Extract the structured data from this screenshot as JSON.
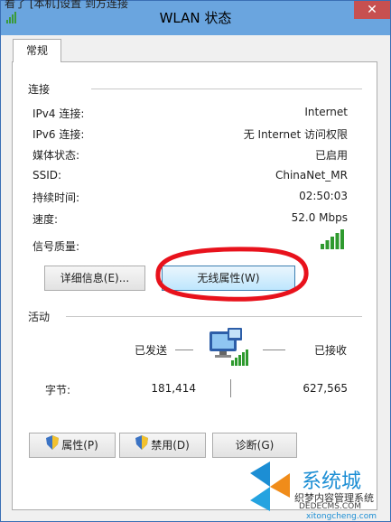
{
  "window": {
    "title": "WLAN 状态",
    "overlay_text": "看了 [本机]设置 到方连接",
    "close_label": "✕"
  },
  "tabs": [
    {
      "label": "常规"
    }
  ],
  "connection": {
    "section_title": "连接",
    "rows": [
      {
        "label": "IPv4 连接:",
        "value": "Internet"
      },
      {
        "label": "IPv6 连接:",
        "value": "无 Internet 访问权限"
      },
      {
        "label": "媒体状态:",
        "value": "已启用"
      },
      {
        "label": "SSID:",
        "value": "ChinaNet_MR"
      },
      {
        "label": "持续时间:",
        "value": "02:50:03"
      },
      {
        "label": "速度:",
        "value": "52.0 Mbps"
      }
    ],
    "signal_label": "信号质量:",
    "signal_bars": 5,
    "details_button": "详细信息(E)...",
    "wireless_props_button": "无线属性(W)"
  },
  "activity": {
    "section_title": "活动",
    "sent_label": "已发送",
    "received_label": "已接收",
    "bytes_label": "字节:",
    "bytes_sent": "181,414",
    "bytes_received": "627,565"
  },
  "buttons": {
    "properties": "属性(P)",
    "disable": "禁用(D)",
    "diagnose": "诊断(G)"
  },
  "watermark": {
    "brand": "系统城",
    "line1": "织梦内容管理系统",
    "line2": "DEDECMS.COM",
    "line3": "xitongcheng.com"
  },
  "colors": {
    "accent": "#6aa5df",
    "annotation": "#e8121c",
    "signal": "#2e9a2e"
  }
}
